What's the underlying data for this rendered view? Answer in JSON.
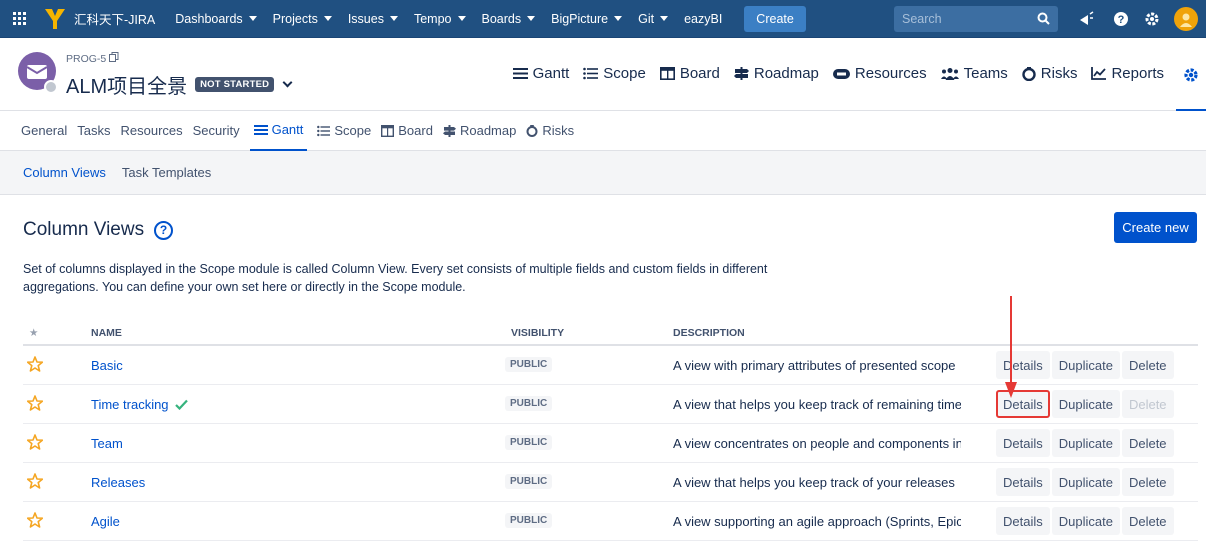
{
  "topnav": {
    "brand": "汇科天下-JIRA",
    "items": [
      {
        "label": "Dashboards",
        "dropdown": true
      },
      {
        "label": "Projects",
        "dropdown": true
      },
      {
        "label": "Issues",
        "dropdown": true
      },
      {
        "label": "Tempo",
        "dropdown": true
      },
      {
        "label": "Boards",
        "dropdown": true
      },
      {
        "label": "BigPicture",
        "dropdown": true
      },
      {
        "label": "Git",
        "dropdown": true
      },
      {
        "label": "eazyBI",
        "dropdown": false
      }
    ],
    "create_label": "Create",
    "search_placeholder": "Search",
    "icons": [
      "app-switcher-icon",
      "notifications-icon",
      "help-icon",
      "settings-icon",
      "user-avatar"
    ]
  },
  "project": {
    "key": "PROG-5",
    "title": "ALM项目全景",
    "status": "NOT STARTED",
    "modules": [
      {
        "label": "Gantt",
        "icon": "gantt-icon"
      },
      {
        "label": "Scope",
        "icon": "scope-icon"
      },
      {
        "label": "Board",
        "icon": "board-icon"
      },
      {
        "label": "Roadmap",
        "icon": "roadmap-icon"
      },
      {
        "label": "Resources",
        "icon": "resources-icon"
      },
      {
        "label": "Teams",
        "icon": "teams-icon"
      },
      {
        "label": "Risks",
        "icon": "risks-icon"
      },
      {
        "label": "Reports",
        "icon": "reports-icon"
      }
    ]
  },
  "subnav": {
    "items": [
      {
        "label": "General"
      },
      {
        "label": "Tasks"
      },
      {
        "label": "Resources"
      },
      {
        "label": "Security"
      },
      {
        "label": "Gantt",
        "icon": "gantt-icon",
        "active": true
      },
      {
        "label": "Scope",
        "icon": "scope-icon"
      },
      {
        "label": "Board",
        "icon": "board-icon"
      },
      {
        "label": "Roadmap",
        "icon": "roadmap-icon"
      },
      {
        "label": "Risks",
        "icon": "risks-icon"
      }
    ]
  },
  "tabs": [
    {
      "label": "Column Views",
      "active": true
    },
    {
      "label": "Task Templates",
      "active": false
    }
  ],
  "content": {
    "title": "Column Views",
    "help": "?",
    "create_new_label": "Create new",
    "description_line1": "Set of columns displayed in the Scope module is called Column View. Every set consists of multiple fields and custom fields in different",
    "description_line2": "aggregations. You can define your own set here or directly in the Scope module."
  },
  "table": {
    "headers": {
      "star": "★",
      "name": "NAME",
      "visibility": "VISIBILITY",
      "description": "DESCRIPTION"
    },
    "rows": [
      {
        "name": "Basic",
        "checked": false,
        "visibility": "PUBLIC",
        "description": "A view with primary attributes of presented scope",
        "details": "Details",
        "duplicate": "Duplicate",
        "delete": "Delete",
        "delete_disabled": false,
        "details_highlighted": false
      },
      {
        "name": "Time tracking",
        "checked": true,
        "visibility": "PUBLIC",
        "description": "A view that helps you keep track of remaining time",
        "details": "Details",
        "duplicate": "Duplicate",
        "delete": "Delete",
        "delete_disabled": true,
        "details_highlighted": true
      },
      {
        "name": "Team",
        "checked": false,
        "visibility": "PUBLIC",
        "description": "A view concentrates on people and components in",
        "details": "Details",
        "duplicate": "Duplicate",
        "delete": "Delete",
        "delete_disabled": false,
        "details_highlighted": false
      },
      {
        "name": "Releases",
        "checked": false,
        "visibility": "PUBLIC",
        "description": "A view that helps you keep track of your releases",
        "details": "Details",
        "duplicate": "Duplicate",
        "delete": "Delete",
        "delete_disabled": false,
        "details_highlighted": false
      },
      {
        "name": "Agile",
        "checked": false,
        "visibility": "PUBLIC",
        "description": "A view supporting an agile approach (Sprints, Epic",
        "details": "Details",
        "duplicate": "Duplicate",
        "delete": "Delete",
        "delete_disabled": false,
        "details_highlighted": false
      }
    ]
  },
  "colors": {
    "topnav_bg": "#205081",
    "primary": "#0052cc",
    "star": "#f5a623",
    "check": "#36b37e",
    "annotation": "#e53935"
  }
}
